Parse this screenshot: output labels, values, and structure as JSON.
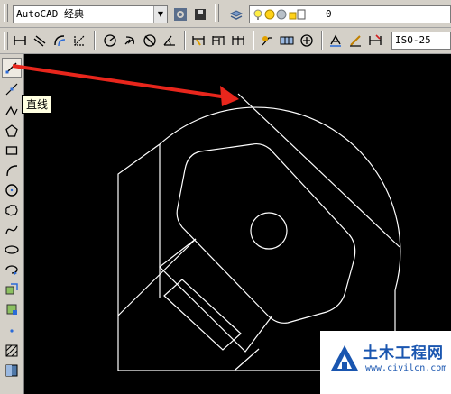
{
  "toolbar_top": {
    "workspace_value": "AutoCAD 经典",
    "layer_value": "0"
  },
  "toolbar_dim": {
    "dimstyle_value": "ISO-25"
  },
  "tooltip": {
    "text": "直线"
  },
  "watermark": {
    "title": "土木工程网",
    "url": "www.civilcn.com"
  },
  "colors": {
    "canvas_bg": "#000000",
    "drawing_lines": "#ffffff",
    "annotation_arrow": "#e8261c",
    "watermark_blue": "#1a56b0"
  },
  "icons": {
    "workspace_settings": "gear-icon",
    "left_tools": [
      "line-icon",
      "construction-line-icon",
      "polyline-icon",
      "polygon-icon",
      "rectangle-icon",
      "arc-icon",
      "circle-icon",
      "revision-cloud-icon",
      "spline-icon",
      "ellipse-icon",
      "ellipse-arc-icon",
      "insert-block-icon",
      "make-block-icon",
      "point-icon",
      "hatch-icon",
      "gradient-icon"
    ]
  }
}
